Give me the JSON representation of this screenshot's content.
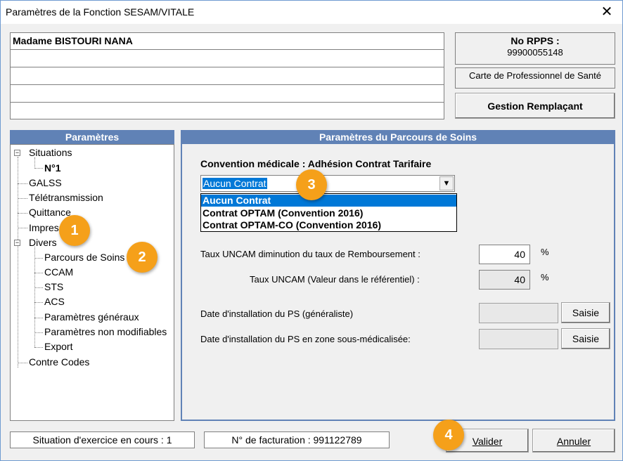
{
  "window": {
    "title": "Paramètres de la Fonction SESAM/VITALE",
    "close_glyph": "✕"
  },
  "patient": {
    "name": "Madame BISTOURI NANA"
  },
  "rpps": {
    "label": "No RPPS :",
    "value": "99900055148",
    "card_label": "Carte de Professionnel de Santé",
    "gestion_button": "Gestion Remplaçant"
  },
  "params": {
    "header": "Paramètres",
    "tree": {
      "situations": "Situations",
      "n1": "N°1",
      "galss": "GALSS",
      "teletransmission": "Télétransmission",
      "quittance": "Quittance",
      "impression": "Impress",
      "divers": "Divers",
      "parcours": "Parcours de Soins",
      "ccam": "CCAM",
      "sts": "STS",
      "acs": "ACS",
      "params_generaux": "Paramètres généraux",
      "params_non_modifiables": "Paramètres non modifiables",
      "export": "Export",
      "contre_codes": "Contre Codes",
      "collapse_glyph": "−"
    }
  },
  "parcours": {
    "header": "Paramètres du Parcours de Soins",
    "convention_label": "Convention médicale : Adhésion Contrat Tarifaire",
    "convention_selected": "Aucun Contrat",
    "convention_options": [
      "Aucun Contrat",
      "Contrat OPTAM (Convention 2016)",
      "Contrat OPTAM-CO (Convention 2016)"
    ],
    "taux_dim_label": "Taux UNCAM diminution du taux de Remboursement :",
    "taux_dim_value": "40",
    "taux_ref_label": "Taux UNCAM (Valeur dans le référentiel)  :",
    "taux_ref_value": "40",
    "pct": "%",
    "date_install_label": "Date d'installation du PS (généraliste)",
    "date_install_zone_label": "Date d'installation du PS en zone sous-médicalisée:",
    "saisie": "Saisie"
  },
  "status": {
    "situation": "Situation d'exercice en cours : 1",
    "facturation": "N° de facturation : 991122789"
  },
  "buttons": {
    "valider": "Valider",
    "annuler": "Annuler"
  },
  "annotations": [
    "1",
    "2",
    "3",
    "4"
  ],
  "colors": {
    "header_blue": "#6082b6",
    "selection_blue": "#0078d7",
    "badge_orange": "#f5a01a"
  }
}
